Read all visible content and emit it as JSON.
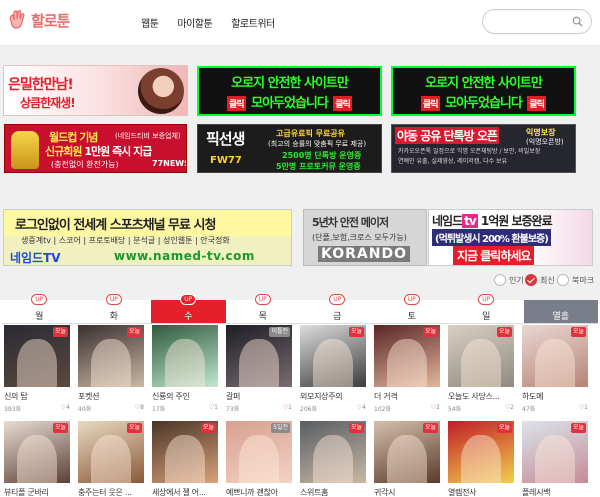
{
  "header": {
    "logo_text": "할로툰",
    "nav": [
      "웹툰",
      "마이할툰",
      "할로트위터"
    ],
    "search_placeholder": ""
  },
  "ads": {
    "a1": {
      "line1": "은밀한만남!",
      "line2": "상큼한재생!"
    },
    "a2": {
      "line1": "오로지 안전한 사이트만",
      "line2": "모아두었습니다",
      "click": "클릭"
    },
    "a3": {
      "line1": "오로지 안전한 사이트만",
      "line2": "모아두었습니다",
      "click": "클릭"
    },
    "a4": {
      "line1": "월드컵 기념",
      "line1_small": "(네임드티비 보증업체)",
      "line2a": "신규회원",
      "line2b": "1만원 즉시 지급",
      "line3": "(충전없이 환전가능)",
      "brand": "77NEWS"
    },
    "a5": {
      "title": "픽선생",
      "sub": "FW77",
      "l1": "고급유료픽 무료공유",
      "l2": "(최고의 승률의 맞춤픽 무료 제공)",
      "l3": "2500명 단톡방 운영중",
      "l4": "5만명 프로토커뮤 운영중"
    },
    "a6": {
      "title": "야동 공유 단톡방 오픈",
      "badge": "익명보장",
      "badge2": "(익명오픈방)",
      "l1": "카카오오픈톡 일정으로 익명 오픈채팅방 / 보안, 비밀보장",
      "l2": "연예인 유출, 실제영상, 레이저캠, 다수 보유",
      "l3": ""
    },
    "a7": {
      "title": "로그인없이 전세계 스포츠채널 무료 시청",
      "sub": "생중계tv | 스코어 | 프로토배당 | 분석글 | 성인웹툰 | 안국정화",
      "brand": "네임드TV",
      "url": "www.named-tv.com"
    },
    "a8": {
      "l1": "5년차 안전 메이저",
      "l2": "(단폴,보험,크로스 모두가능)",
      "brand": "KORANDO"
    },
    "a9": {
      "l1a": "네임드",
      "l1b": "tv",
      "l1c": " 1억원 보증완료",
      "l2": "(먹튀발생시 200% 환불보증)",
      "l3": "지금 클릭하세요"
    }
  },
  "sort": {
    "options": [
      "인기",
      "최신",
      "북마크"
    ],
    "selected": "최신"
  },
  "tabs": {
    "labels": [
      "월",
      "화",
      "수",
      "목",
      "금",
      "토",
      "일",
      "열흘"
    ],
    "up_label": "UP",
    "active": "수"
  },
  "comics": [
    {
      "title": "신의 탑",
      "views": "393화",
      "likes": "4",
      "badge": "오늘",
      "colors": [
        "#2a2a33",
        "#5b4a3f"
      ]
    },
    {
      "title": "포켓션",
      "views": "40화",
      "likes": "8",
      "badge": "오늘",
      "colors": [
        "#3b3031",
        "#c9b8a3"
      ]
    },
    {
      "title": "신룡의 주인",
      "views": "17화",
      "likes": "1",
      "badge": "",
      "colors": [
        "#2f5a3a",
        "#bfe8d0"
      ]
    },
    {
      "title": "갈퍼",
      "views": "73화",
      "likes": "1",
      "badge": "이틀전",
      "colors": [
        "#1e1e24",
        "#7a6a73"
      ]
    },
    {
      "title": "외모지상주의",
      "views": "206화",
      "likes": "4",
      "badge": "오늘",
      "colors": [
        "#dcdcdc",
        "#3c3c3c"
      ]
    },
    {
      "title": "더 거격",
      "views": "102화",
      "likes": "2",
      "badge": "오늘",
      "colors": [
        "#5a2525",
        "#e2b79d"
      ]
    },
    {
      "title": "오늘도 사당스...",
      "views": "54화",
      "likes": "2",
      "badge": "오늘",
      "colors": [
        "#d8cfc4",
        "#8f8a7f"
      ]
    },
    {
      "title": "하도메",
      "views": "47화",
      "likes": "1",
      "badge": "오늘",
      "colors": [
        "#e9d7d3",
        "#b68576"
      ]
    },
    {
      "title": "뷰티플 군바리",
      "views": "",
      "likes": "",
      "badge": "오늘",
      "colors": [
        "#e8dcd4",
        "#5a4034"
      ]
    },
    {
      "title": "충주는터 웃은 ...",
      "views": "",
      "likes": "",
      "badge": "오늘",
      "colors": [
        "#e9d9c2",
        "#8a5a3a"
      ]
    },
    {
      "title": "세상에서 젤 어...",
      "views": "",
      "likes": "",
      "badge": "오늘",
      "colors": [
        "#4a3528",
        "#d8a17a"
      ]
    },
    {
      "title": "예쁘니까 괜찮아",
      "views": "",
      "likes": "",
      "badge": "5일전",
      "colors": [
        "#d8a090",
        "#f3d2c2"
      ]
    },
    {
      "title": "스위트홈",
      "views": "",
      "likes": "",
      "badge": "오늘",
      "colors": [
        "#5a5e63",
        "#c7b7a5"
      ]
    },
    {
      "title": "귀각시",
      "views": "",
      "likes": "",
      "badge": "오늘",
      "colors": [
        "#d4c0ad",
        "#5b3a2a"
      ]
    },
    {
      "title": "열렙전사",
      "views": "",
      "likes": "",
      "badge": "오늘",
      "colors": [
        "#c21d2a",
        "#f0d04a"
      ]
    },
    {
      "title": "플레시백",
      "views": "",
      "likes": "",
      "badge": "오늘",
      "colors": [
        "#dbe3ea",
        "#c58b97"
      ]
    }
  ]
}
